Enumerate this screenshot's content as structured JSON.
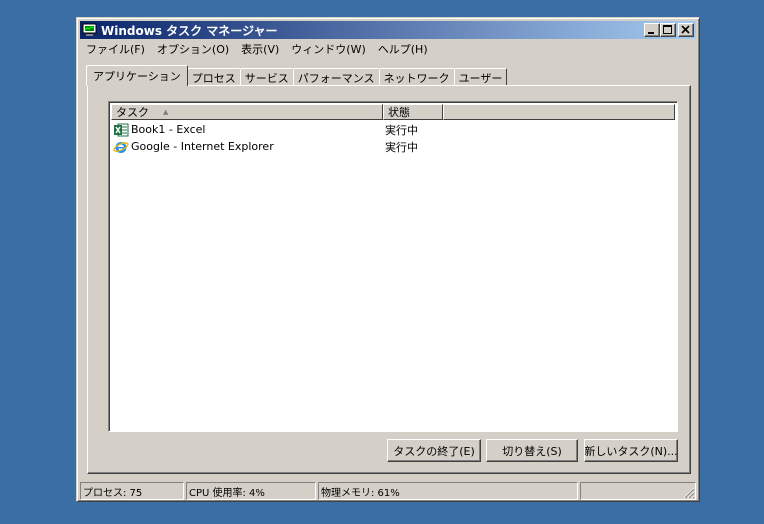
{
  "window": {
    "title": "Windows タスク マネージャー"
  },
  "menu": [
    "ファイル(F)",
    "オプション(O)",
    "表示(V)",
    "ウィンドウ(W)",
    "ヘルプ(H)"
  ],
  "tabs": [
    "アプリケーション",
    "プロセス",
    "サービス",
    "パフォーマンス",
    "ネットワーク",
    "ユーザー"
  ],
  "columns": {
    "task": "タスク",
    "status": "状態"
  },
  "tasks": [
    {
      "name": "Book1 - Excel",
      "status": "実行中",
      "icon": "excel-icon"
    },
    {
      "name": "Google - Internet Explorer",
      "status": "実行中",
      "icon": "ie-icon"
    }
  ],
  "buttons": {
    "end_task": "タスクの終了(E)",
    "switch_to": "切り替え(S)",
    "new_task": "新しいタスク(N)..."
  },
  "statusbar": {
    "processes": "プロセス: 75",
    "cpu": "CPU 使用率: 4%",
    "memory": "物理メモリ: 61%"
  },
  "colors": {
    "desktop": "#3a6ea5",
    "title_start": "#0a246a",
    "title_end": "#a6caf0",
    "face": "#d4d0c8"
  }
}
